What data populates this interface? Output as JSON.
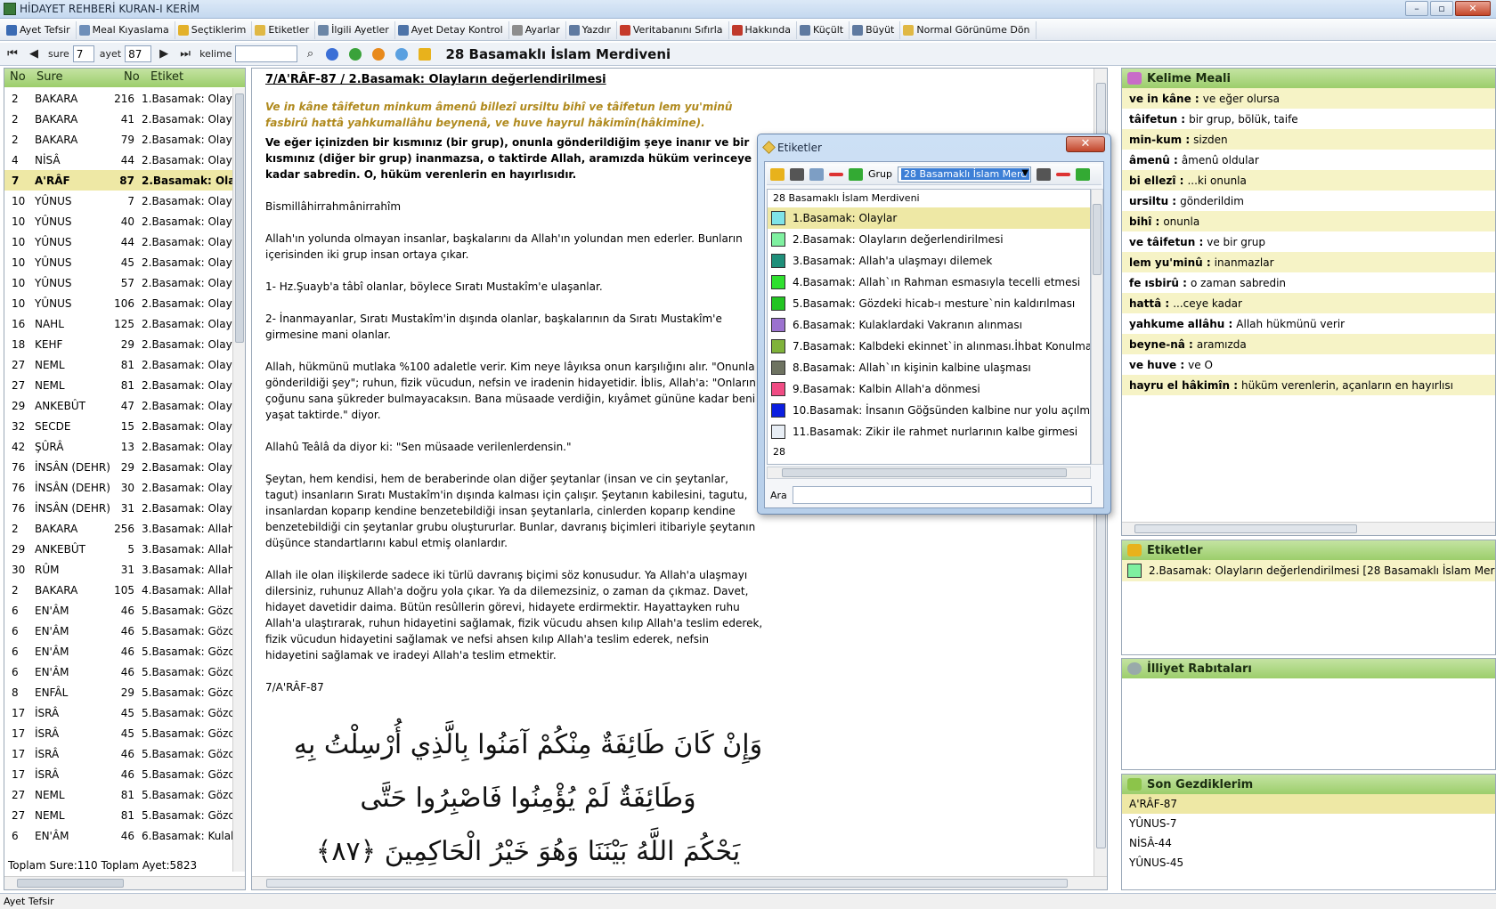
{
  "window": {
    "title": "HİDAYET REHBERİ KURAN-I KERİM"
  },
  "menu": [
    {
      "label": "Ayet Tefsir",
      "color": "#3b6bb3"
    },
    {
      "label": "Meal Kıyaslama",
      "color": "#6f8fb9"
    },
    {
      "label": "Seçtiklerim",
      "color": "#e3b12a"
    },
    {
      "label": "Etiketler",
      "color": "#e0b844"
    },
    {
      "label": "İlgili Ayetler",
      "color": "#6b86a6"
    },
    {
      "label": "Ayet Detay Kontrol",
      "color": "#4e74a8"
    },
    {
      "label": "Ayarlar",
      "color": "#8d8d8d"
    },
    {
      "label": "Yazdır",
      "color": "#5f7aa0"
    },
    {
      "label": "Veritabanını Sıfırla",
      "color": "#c53a2a"
    },
    {
      "label": "Hakkında",
      "color": "#c0392b"
    },
    {
      "label": "Küçült",
      "color": "#5f7aa0"
    },
    {
      "label": "Büyüt",
      "color": "#5f7aa0"
    },
    {
      "label": "Normal Görünüme Dön",
      "color": "#e0b844"
    }
  ],
  "nav": {
    "sure_label": "sure",
    "sure_value": "7",
    "ayet_label": "ayet",
    "ayet_value": "87",
    "kelime_label": "kelime",
    "kelime_value": "",
    "title": "28 Basamaklı İslam Merdiveni"
  },
  "left": {
    "headers": {
      "no": "No",
      "sure": "Sure",
      "no2": "No",
      "etiket": "Etiket"
    },
    "rows": [
      {
        "no": "2",
        "sure": "BAKARA",
        "ayet": "216",
        "etiket": "1.Basamak: Olayl"
      },
      {
        "no": "2",
        "sure": "BAKARA",
        "ayet": "41",
        "etiket": "2.Basamak: Olayl"
      },
      {
        "no": "2",
        "sure": "BAKARA",
        "ayet": "79",
        "etiket": "2.Basamak: Olayl"
      },
      {
        "no": "4",
        "sure": "NİSÂ",
        "ayet": "44",
        "etiket": "2.Basamak: Olayl"
      },
      {
        "no": "7",
        "sure": "A'RÂF",
        "ayet": "87",
        "etiket": "2.Basamak: Olay",
        "selected": true
      },
      {
        "no": "10",
        "sure": "YÛNUS",
        "ayet": "7",
        "etiket": "2.Basamak: Olayl"
      },
      {
        "no": "10",
        "sure": "YÛNUS",
        "ayet": "40",
        "etiket": "2.Basamak: Olayl"
      },
      {
        "no": "10",
        "sure": "YÛNUS",
        "ayet": "44",
        "etiket": "2.Basamak: Olayl"
      },
      {
        "no": "10",
        "sure": "YÛNUS",
        "ayet": "45",
        "etiket": "2.Basamak: Olayl"
      },
      {
        "no": "10",
        "sure": "YÛNUS",
        "ayet": "57",
        "etiket": "2.Basamak: Olayl"
      },
      {
        "no": "10",
        "sure": "YÛNUS",
        "ayet": "106",
        "etiket": "2.Basamak: Olayl"
      },
      {
        "no": "16",
        "sure": "NAHL",
        "ayet": "125",
        "etiket": "2.Basamak: Olayl"
      },
      {
        "no": "18",
        "sure": "KEHF",
        "ayet": "29",
        "etiket": "2.Basamak: Olayl"
      },
      {
        "no": "27",
        "sure": "NEML",
        "ayet": "81",
        "etiket": "2.Basamak: Olayl"
      },
      {
        "no": "27",
        "sure": "NEML",
        "ayet": "81",
        "etiket": "2.Basamak: Olayl"
      },
      {
        "no": "29",
        "sure": "ANKEBÛT",
        "ayet": "47",
        "etiket": "2.Basamak: Olayl"
      },
      {
        "no": "32",
        "sure": "SECDE",
        "ayet": "15",
        "etiket": "2.Basamak: Olayl"
      },
      {
        "no": "42",
        "sure": "ŞÛRÂ",
        "ayet": "13",
        "etiket": "2.Basamak: Olayl"
      },
      {
        "no": "76",
        "sure": "İNSÂN (DEHR)",
        "ayet": "29",
        "etiket": "2.Basamak: Olayl"
      },
      {
        "no": "76",
        "sure": "İNSÂN (DEHR)",
        "ayet": "30",
        "etiket": "2.Basamak: Olayl"
      },
      {
        "no": "76",
        "sure": "İNSÂN (DEHR)",
        "ayet": "31",
        "etiket": "2.Basamak: Olayl"
      },
      {
        "no": "2",
        "sure": "BAKARA",
        "ayet": "256",
        "etiket": "3.Basamak: Allah"
      },
      {
        "no": "29",
        "sure": "ANKEBÛT",
        "ayet": "5",
        "etiket": "3.Basamak: Allah"
      },
      {
        "no": "30",
        "sure": "RÛM",
        "ayet": "31",
        "etiket": "3.Basamak: Allah"
      },
      {
        "no": "2",
        "sure": "BAKARA",
        "ayet": "105",
        "etiket": "4.Basamak: Allah"
      },
      {
        "no": "6",
        "sure": "EN'ÂM",
        "ayet": "46",
        "etiket": "5.Basamak: Gözc"
      },
      {
        "no": "6",
        "sure": "EN'ÂM",
        "ayet": "46",
        "etiket": "5.Basamak: Gözc"
      },
      {
        "no": "6",
        "sure": "EN'ÂM",
        "ayet": "46",
        "etiket": "5.Basamak: Gözc"
      },
      {
        "no": "6",
        "sure": "EN'ÂM",
        "ayet": "46",
        "etiket": "5.Basamak: Gözc"
      },
      {
        "no": "8",
        "sure": "ENFÂL",
        "ayet": "29",
        "etiket": "5.Basamak: Gözc"
      },
      {
        "no": "17",
        "sure": "İSRÂ",
        "ayet": "45",
        "etiket": "5.Basamak: Gözc"
      },
      {
        "no": "17",
        "sure": "İSRÂ",
        "ayet": "45",
        "etiket": "5.Basamak: Gözc"
      },
      {
        "no": "17",
        "sure": "İSRÂ",
        "ayet": "46",
        "etiket": "5.Basamak: Gözc"
      },
      {
        "no": "17",
        "sure": "İSRÂ",
        "ayet": "46",
        "etiket": "5.Basamak: Gözc"
      },
      {
        "no": "27",
        "sure": "NEML",
        "ayet": "81",
        "etiket": "5.Basamak: Gözc"
      },
      {
        "no": "27",
        "sure": "NEML",
        "ayet": "81",
        "etiket": "5.Basamak: Gözc"
      },
      {
        "no": "6",
        "sure": "EN'ÂM",
        "ayet": "46",
        "etiket": "6.Basamak: Kulak"
      }
    ],
    "footer": "Toplam Sure:110 Toplam Ayet:5823"
  },
  "middle": {
    "title": "7/A'RÂF-87 / 2.Basamak: Olayların değerlendirilmesi",
    "transliteration": "Ve in kâne tâifetun minkum âmenû billezî ursiltu bihî ve tâifetun lem yu'minû fasbirû hattâ yahkumallâhu beynenâ, ve huve hayrul hâkimîn(hâkimîne).",
    "meal": "Ve eğer içinizden bir kısmınız (bir grup), onunla gönderildiğim şeye inanır ve bir kısmınız (diğer bir grup) inanmazsa, o taktirde Allah, aramızda hüküm verinceye kadar sabredin. O, hüküm verenlerin en hayırlısıdır.",
    "paragraphs": [
      "Bismillâhirrahmânirrahîm",
      "Allah'ın yolunda olmayan insanlar, başkalarını da Allah'ın yolundan men ederler. Bunların içerisinden iki grup insan ortaya çıkar.",
      "1- Hz.Şuayb'a tâbî olanlar, böylece Sıratı Mustakîm'e ulaşanlar.",
      "2- İnanmayanlar, Sıratı Mustakîm'in dışında olanlar, başkalarının da Sıratı Mustakîm'e girmesine mani olanlar.",
      "Allah, hükmünü mutlaka %100 adaletle verir. Kim neye lâyıksa onun karşılığını alır. \"Onunla gönderildiği şey\"; ruhun, fizik vücudun, nefsin ve iradenin hidayetidir. İblis, Allah'a: \"Onların çoğunu sana şükreder bulmayacaksın. Bana müsaade verdiğin, kıyâmet gününe kadar beni yaşat taktirde.\" diyor.",
      "Allahû Teâlâ da diyor ki: \"Sen müsaade verilenlerdensin.\"",
      "Şeytan, hem kendisi, hem de beraberinde olan diğer şeytanlar (insan ve cin şeytanlar, tagut) insanların Sıratı Mustakîm'in dışında kalması için çalışır. Şeytanın kabilesini, tagutu, insanlardan koparıp kendine benzetebildiği insan şeytanlarla, cinlerden koparıp kendine benzetebildiği cin şeytanlar grubu oluştururlar. Bunlar, davranış biçimleri itibariyle şeytanın düşünce standartlarını kabul etmiş olanlardır.",
      "Allah ile olan ilişkilerde sadece iki türlü davranış biçimi söz konusudur. Ya Allah'a ulaşmayı dilersiniz, ruhunuz Allah'a doğru yola çıkar. Ya da dilemezsiniz, o zaman da çıkmaz. Davet, hidayet davetidir daima. Bütün resûllerin görevi, hidayete erdirmektir. Hayattayken ruhu Allah'a ulaştırarak, ruhun hidayetini sağlamak, fizik vücudu ahsen kılıp Allah'a teslim ederek, fizik vücudun hidayetini sağlamak ve nefsi ahsen kılıp Allah'a teslim ederek, nefsin hidayetini sağlamak ve iradeyi Allah'a teslim etmektir.",
      "7/A'RÂF-87"
    ],
    "arabic_line1": "وَإِنْ كَانَ طَائِفَةٌ مِنْكُمْ آمَنُوا بِالَّذِي أُرْسِلْتُ بِهِ وَطَائِفَةٌ لَمْ يُؤْمِنُوا فَاصْبِرُوا حَتَّى",
    "arabic_line2": "يَحْكُمَ اللَّهُ بَيْنَنَا وَهُوَ خَيْرُ الْحَاكِمِينَ ﴿٨٧﴾"
  },
  "dialog": {
    "title": "Etiketler",
    "close": "✕",
    "grup_label": "Grup",
    "grup_value": "28 Basamaklı İslam Merd",
    "list_header": "28 Basamaklı İslam Merdiveni",
    "items": [
      {
        "label": "1.Basamak: Olaylar",
        "color": "#7fe3e8",
        "selected": true
      },
      {
        "label": "2.Basamak: Olayların değerlendirilmesi",
        "color": "#7ff0a0"
      },
      {
        "label": "3.Basamak: Allah'a ulaşmayı dilemek",
        "color": "#1f8f7a"
      },
      {
        "label": "4.Basamak: Allah`ın Rahman esmasıyla tecelli etmesi",
        "color": "#2fe02f"
      },
      {
        "label": "5.Basamak: Gözdeki hicab-ı mesture`nin kaldırılması",
        "color": "#22c422"
      },
      {
        "label": "6.Basamak: Kulaklardaki Vakranın alınması",
        "color": "#9b72cf"
      },
      {
        "label": "7.Basamak: Kalbdeki ekinnet`in alınması.İhbat Konulma",
        "color": "#7fb23a"
      },
      {
        "label": "8.Basamak: Allah`ın kişinin kalbine ulaşması",
        "color": "#6e7361"
      },
      {
        "label": "9.Basamak: Kalbin Allah'a dönmesi",
        "color": "#f04c84"
      },
      {
        "label": "10.Basamak: İnsanın Göğsünden kalbine nur yolu açılma",
        "color": "#0b1ee0"
      },
      {
        "label": "11.Basamak: Zikir ile rahmet nurlarının kalbe girmesi",
        "color": "#e8eef5"
      }
    ],
    "count": "28",
    "search_label": "Ara",
    "search_value": ""
  },
  "kelime": {
    "title": "Kelime Meali",
    "rows": [
      {
        "k": "ve in kâne :",
        "m": "ve eğer olursa"
      },
      {
        "k": "tâifetun :",
        "m": "bir grup, bölük, taife"
      },
      {
        "k": "min-kum :",
        "m": "sizden"
      },
      {
        "k": "âmenû :",
        "m": "âmenû oldular"
      },
      {
        "k": "bi ellezî :",
        "m": "...ki onunla"
      },
      {
        "k": "ursiltu :",
        "m": "gönderildim"
      },
      {
        "k": "bihî :",
        "m": "onunla"
      },
      {
        "k": "ve tâifetun :",
        "m": "ve bir grup"
      },
      {
        "k": "lem yu'minû :",
        "m": "inanmazlar"
      },
      {
        "k": "fe ısbirû :",
        "m": "o zaman sabredin"
      },
      {
        "k": "hattâ :",
        "m": "...ceye kadar"
      },
      {
        "k": "yahkume allâhu :",
        "m": "Allah hükmünü verir"
      },
      {
        "k": "beyne-nâ :",
        "m": "aramızda"
      },
      {
        "k": "ve huve :",
        "m": "ve O"
      },
      {
        "k": "hayru el hâkimîn :",
        "m": "hüküm verenlerin, açanların en hayırlısı"
      }
    ]
  },
  "etiketler": {
    "title": "Etiketler",
    "item": "2.Basamak: Olayların değerlendirilmesi [28 Basamaklı İslam Merdi",
    "color": "#7ff0a0"
  },
  "illiyet": {
    "title": "İlliyet Rabıtaları"
  },
  "son": {
    "title": "Son Gezdiklerim",
    "items": [
      "A'RÂF-87",
      "YÛNUS-7",
      "NİSÂ-44",
      "YÛNUS-45"
    ]
  },
  "status": "Ayet Tefsir"
}
